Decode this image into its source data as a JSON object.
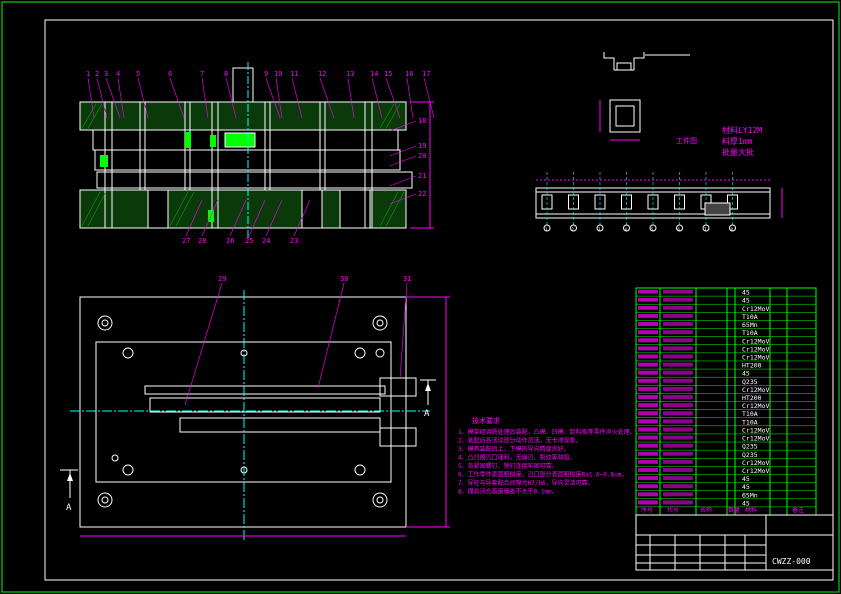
{
  "drawing": {
    "background": "#000000",
    "colors": {
      "border": "#00ff00",
      "outline": "#ffffff",
      "center": "#00ffff",
      "leader": "#ff00ff",
      "section": "#00ff00",
      "text": "#ff00ff",
      "table_line": "#00ff00",
      "table_text": "#ffffff",
      "dimension": "#ff00ff",
      "highlight": "#00ff00"
    },
    "front_view_callouts": [
      "1",
      "2",
      "3",
      "4",
      "5",
      "6",
      "7",
      "8",
      "9",
      "10",
      "11",
      "12",
      "13",
      "14",
      "15",
      "16",
      "17",
      "18",
      "19",
      "20",
      "21",
      "22",
      "23",
      "24",
      "25",
      "26",
      "27",
      "28"
    ],
    "bottom_callouts": [
      "27",
      "28",
      "26",
      "25",
      "24",
      "23"
    ],
    "plan_callouts": [
      "29",
      "30",
      "31"
    ],
    "section_mark": "A",
    "strip_positions": [
      "1",
      "2",
      "3",
      "4",
      "5",
      "6",
      "7",
      "8"
    ],
    "workpiece_title": "工件图",
    "workpiece_props": [
      {
        "label": "材料",
        "value": "LY12M"
      },
      {
        "label": "料厚",
        "value": "1mm"
      },
      {
        "label": "批量",
        "value": "大批"
      }
    ],
    "tech_title": "技术要求",
    "tech_requirements": [
      "1、模架经调质处理后装配，凸模、凹模、卸料板等零件淬火处理。",
      "2、装配后各活动部分动作灵活，无卡滞现象。",
      "3、模具装配后上、下模的导向精度良好。",
      "4、凸凹模刃口锋利，无崩刃、裂纹等缺陷。",
      "5、各紧固螺钉、销钉连接牢固可靠。",
      "6、工作零件表面粗糙度，刃口部分表面粗糙度Ra1.6~0.8um。",
      "7、导柱与导套配合间隙为H7/h6，导向灵活可靠。",
      "8、模具闭合高度偏差不大于0.1mm。"
    ],
    "parts_materials": [
      "45",
      "45",
      "Cr12MoV",
      "T10A",
      "65Mn",
      "T10A",
      "Cr12MoV",
      "Cr12MoV",
      "Cr12MoV",
      "HT200",
      "45",
      "Q235",
      "Cr12MoV",
      "HT200",
      "Cr12MoV",
      "T10A",
      "T10A",
      "Cr12MoV",
      "Cr12MoV",
      "Q235",
      "Q235",
      "Cr12MoV",
      "Cr12MoV",
      "45",
      "45",
      "65Mn",
      "45"
    ],
    "title_block": {
      "drawing_no": "CWZZ-000",
      "header": [
        "序号",
        "代号",
        "名称",
        "数量",
        "材料",
        "备注"
      ]
    }
  }
}
